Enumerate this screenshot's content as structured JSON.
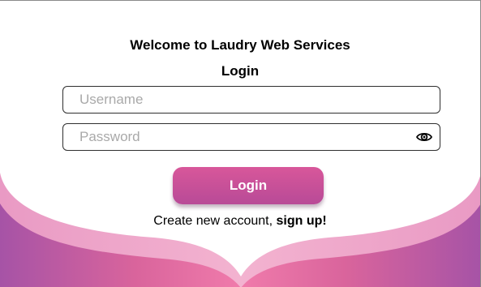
{
  "header": {
    "welcome_text": "Welcome to Laudry Web Services",
    "form_title": "Login"
  },
  "form": {
    "username_placeholder": "Username",
    "password_placeholder": "Password",
    "login_label": "Login"
  },
  "footer": {
    "prompt_text": "Create new account, ",
    "signup_link": "sign up!"
  },
  "icons": {
    "password_toggle": "eye-icon"
  },
  "colors": {
    "accent_pink": "#d8579a",
    "accent_purple": "#a653a6",
    "wave_light": "#e99ac4"
  }
}
